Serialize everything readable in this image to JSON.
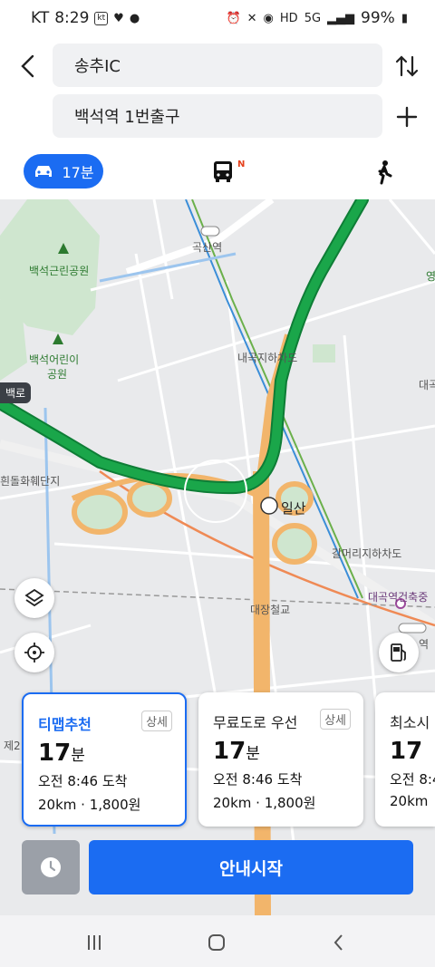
{
  "status": {
    "carrier": "KT",
    "time": "8:29",
    "carrier_badge": "kt",
    "network": "5G",
    "battery": "99%"
  },
  "route": {
    "origin": "송추IC",
    "destination": "백석역 1번출구"
  },
  "modes": {
    "car_label": "17분",
    "bus_badge": "N"
  },
  "map": {
    "labels": {
      "park1": "백석근린공원",
      "park2a": "백석어린이",
      "park2b": "공원",
      "station1": "곡산역",
      "underpass1": "내곡지하차도",
      "ic": "일산",
      "complex": "흰돌화훼단지",
      "underpass2": "갈머리지하차도",
      "bridge": "대장철교",
      "station2": "대곡역건축중",
      "edge1": "대곡",
      "edge2": "역",
      "edge3": "영",
      "edge4": "제2"
    },
    "road_tag": "백로"
  },
  "cards": [
    {
      "title": "티맵추천",
      "detail": "상세",
      "time": "17",
      "unit": "분",
      "arrival": "오전 8:46 도착",
      "dist": "20km",
      "fare": "1,800원"
    },
    {
      "title": "무료도로 우선",
      "detail": "상세",
      "time": "17",
      "unit": "분",
      "arrival": "오전 8:46 도착",
      "dist": "20km",
      "fare": "1,800원"
    },
    {
      "title": "최소시",
      "time": "17",
      "arrival": "오전 8:4",
      "dist": "20km"
    }
  ],
  "start_button": "안내시작",
  "colors": {
    "accent": "#1b6cf2",
    "route": "#1aa64a",
    "highway": "#f2b56b"
  }
}
